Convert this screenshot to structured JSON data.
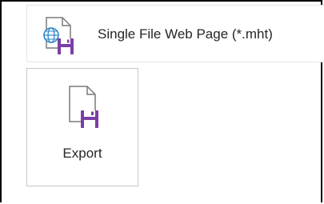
{
  "file_type_option": {
    "label": "Single File Web Page (*.mht)",
    "icon": "mht-file-save-icon"
  },
  "export_button": {
    "label": "Export",
    "icon": "export-file-save-icon"
  },
  "colors": {
    "accent_purple": "#7b3fa6",
    "globe_blue": "#2e86c8",
    "outline_gray": "#7a7a7a"
  }
}
